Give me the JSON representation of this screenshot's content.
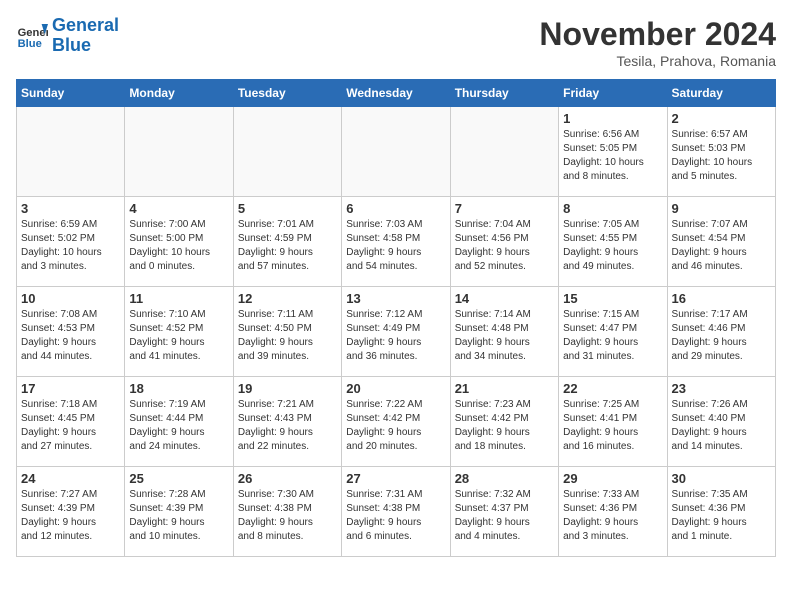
{
  "header": {
    "logo_line1": "General",
    "logo_line2": "Blue",
    "month": "November 2024",
    "location": "Tesila, Prahova, Romania"
  },
  "days_of_week": [
    "Sunday",
    "Monday",
    "Tuesday",
    "Wednesday",
    "Thursday",
    "Friday",
    "Saturday"
  ],
  "weeks": [
    [
      {
        "day": "",
        "detail": "",
        "empty": true
      },
      {
        "day": "",
        "detail": "",
        "empty": true
      },
      {
        "day": "",
        "detail": "",
        "empty": true
      },
      {
        "day": "",
        "detail": "",
        "empty": true
      },
      {
        "day": "",
        "detail": "",
        "empty": true
      },
      {
        "day": "1",
        "detail": "Sunrise: 6:56 AM\nSunset: 5:05 PM\nDaylight: 10 hours\nand 8 minutes.",
        "empty": false
      },
      {
        "day": "2",
        "detail": "Sunrise: 6:57 AM\nSunset: 5:03 PM\nDaylight: 10 hours\nand 5 minutes.",
        "empty": false
      }
    ],
    [
      {
        "day": "3",
        "detail": "Sunrise: 6:59 AM\nSunset: 5:02 PM\nDaylight: 10 hours\nand 3 minutes.",
        "empty": false
      },
      {
        "day": "4",
        "detail": "Sunrise: 7:00 AM\nSunset: 5:00 PM\nDaylight: 10 hours\nand 0 minutes.",
        "empty": false
      },
      {
        "day": "5",
        "detail": "Sunrise: 7:01 AM\nSunset: 4:59 PM\nDaylight: 9 hours\nand 57 minutes.",
        "empty": false
      },
      {
        "day": "6",
        "detail": "Sunrise: 7:03 AM\nSunset: 4:58 PM\nDaylight: 9 hours\nand 54 minutes.",
        "empty": false
      },
      {
        "day": "7",
        "detail": "Sunrise: 7:04 AM\nSunset: 4:56 PM\nDaylight: 9 hours\nand 52 minutes.",
        "empty": false
      },
      {
        "day": "8",
        "detail": "Sunrise: 7:05 AM\nSunset: 4:55 PM\nDaylight: 9 hours\nand 49 minutes.",
        "empty": false
      },
      {
        "day": "9",
        "detail": "Sunrise: 7:07 AM\nSunset: 4:54 PM\nDaylight: 9 hours\nand 46 minutes.",
        "empty": false
      }
    ],
    [
      {
        "day": "10",
        "detail": "Sunrise: 7:08 AM\nSunset: 4:53 PM\nDaylight: 9 hours\nand 44 minutes.",
        "empty": false
      },
      {
        "day": "11",
        "detail": "Sunrise: 7:10 AM\nSunset: 4:52 PM\nDaylight: 9 hours\nand 41 minutes.",
        "empty": false
      },
      {
        "day": "12",
        "detail": "Sunrise: 7:11 AM\nSunset: 4:50 PM\nDaylight: 9 hours\nand 39 minutes.",
        "empty": false
      },
      {
        "day": "13",
        "detail": "Sunrise: 7:12 AM\nSunset: 4:49 PM\nDaylight: 9 hours\nand 36 minutes.",
        "empty": false
      },
      {
        "day": "14",
        "detail": "Sunrise: 7:14 AM\nSunset: 4:48 PM\nDaylight: 9 hours\nand 34 minutes.",
        "empty": false
      },
      {
        "day": "15",
        "detail": "Sunrise: 7:15 AM\nSunset: 4:47 PM\nDaylight: 9 hours\nand 31 minutes.",
        "empty": false
      },
      {
        "day": "16",
        "detail": "Sunrise: 7:17 AM\nSunset: 4:46 PM\nDaylight: 9 hours\nand 29 minutes.",
        "empty": false
      }
    ],
    [
      {
        "day": "17",
        "detail": "Sunrise: 7:18 AM\nSunset: 4:45 PM\nDaylight: 9 hours\nand 27 minutes.",
        "empty": false
      },
      {
        "day": "18",
        "detail": "Sunrise: 7:19 AM\nSunset: 4:44 PM\nDaylight: 9 hours\nand 24 minutes.",
        "empty": false
      },
      {
        "day": "19",
        "detail": "Sunrise: 7:21 AM\nSunset: 4:43 PM\nDaylight: 9 hours\nand 22 minutes.",
        "empty": false
      },
      {
        "day": "20",
        "detail": "Sunrise: 7:22 AM\nSunset: 4:42 PM\nDaylight: 9 hours\nand 20 minutes.",
        "empty": false
      },
      {
        "day": "21",
        "detail": "Sunrise: 7:23 AM\nSunset: 4:42 PM\nDaylight: 9 hours\nand 18 minutes.",
        "empty": false
      },
      {
        "day": "22",
        "detail": "Sunrise: 7:25 AM\nSunset: 4:41 PM\nDaylight: 9 hours\nand 16 minutes.",
        "empty": false
      },
      {
        "day": "23",
        "detail": "Sunrise: 7:26 AM\nSunset: 4:40 PM\nDaylight: 9 hours\nand 14 minutes.",
        "empty": false
      }
    ],
    [
      {
        "day": "24",
        "detail": "Sunrise: 7:27 AM\nSunset: 4:39 PM\nDaylight: 9 hours\nand 12 minutes.",
        "empty": false
      },
      {
        "day": "25",
        "detail": "Sunrise: 7:28 AM\nSunset: 4:39 PM\nDaylight: 9 hours\nand 10 minutes.",
        "empty": false
      },
      {
        "day": "26",
        "detail": "Sunrise: 7:30 AM\nSunset: 4:38 PM\nDaylight: 9 hours\nand 8 minutes.",
        "empty": false
      },
      {
        "day": "27",
        "detail": "Sunrise: 7:31 AM\nSunset: 4:38 PM\nDaylight: 9 hours\nand 6 minutes.",
        "empty": false
      },
      {
        "day": "28",
        "detail": "Sunrise: 7:32 AM\nSunset: 4:37 PM\nDaylight: 9 hours\nand 4 minutes.",
        "empty": false
      },
      {
        "day": "29",
        "detail": "Sunrise: 7:33 AM\nSunset: 4:36 PM\nDaylight: 9 hours\nand 3 minutes.",
        "empty": false
      },
      {
        "day": "30",
        "detail": "Sunrise: 7:35 AM\nSunset: 4:36 PM\nDaylight: 9 hours\nand 1 minute.",
        "empty": false
      }
    ]
  ]
}
